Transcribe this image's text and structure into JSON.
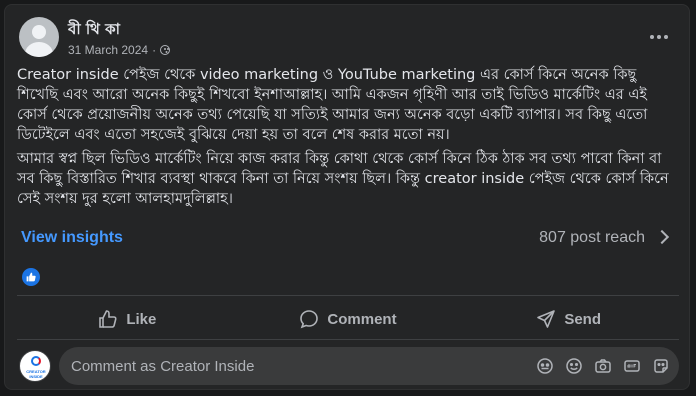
{
  "post": {
    "author": "বী থি কা",
    "date": "31 March 2024",
    "separator": "·",
    "paragraphs": [
      "Creator inside পেইজ থেকে video marketing ও YouTube marketing এর কোর্স কিনে অনেক কিছু শিখেছি এবং আরো অনেক কিছুই শিখবো ইনশাআল্লাহ। আমি একজন গৃহিণী আর তাই ভিডিও মার্কেটিং এর এই কোর্স থেকে প্রয়োজনীয় অনেক তথ্য পেয়েছি যা সত্যিই আমার জন্য অনেক বড়ো একটি ব্যাপার। সব কিছু এতো ডিটেইলে এবং এতো সহজেই বুঝিয়ে দেয়া হয় তা বলে শেষ করার মতো নয়।",
      "আমার স্বপ্ন ছিল ভিডিও মার্কেটিং নিয়ে কাজ করার কিন্তু কোথা থেকে কোর্স কিনে ঠিক ঠাক সব তথ্য পাবো কিনা বা সব কিছু বিস্তারিত শিখার ব্যবস্থা থাকবে কিনা তা নিয়ে সংশয় ছিল। কিন্তু creator inside পেইজ থেকে কোর্স কিনে সেই সংশয় দুর হলো আলহামদুলিল্লাহ।"
    ]
  },
  "insights": {
    "link_label": "View insights",
    "reach_label": "807 post reach"
  },
  "actions": {
    "like": "Like",
    "comment": "Comment",
    "send": "Send"
  },
  "comment_box": {
    "placeholder": "Comment as Creator Inside",
    "avatar_text": "CREATOR INSIDE"
  },
  "colors": {
    "background": "#242526",
    "link": "#4599ff",
    "like_badge": "#1b74e4"
  }
}
